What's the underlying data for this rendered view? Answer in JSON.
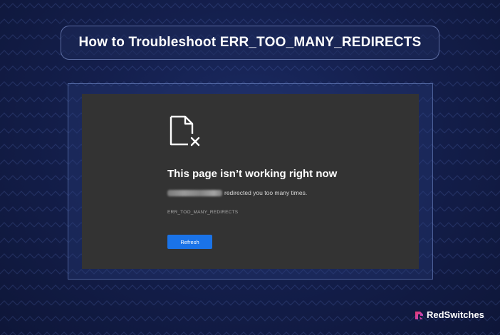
{
  "title": "How to Troubleshoot ERR_TOO_MANY_REDIRECTS",
  "error_page": {
    "heading": "This page isn’t working right now",
    "message_suffix": "redirected you too many times.",
    "error_code": "ERR_TOO_MANY_REDIRECTS",
    "refresh_label": "Refresh",
    "icon": "broken-document-icon"
  },
  "brand": {
    "name": "RedSwitches",
    "logo_icon": "redswitches-logo-icon",
    "logo_colors": [
      "#e83a6b",
      "#b04bd8"
    ]
  },
  "colors": {
    "background": "#141f4d",
    "browser_panel": "#333333",
    "button": "#1a73e8"
  }
}
